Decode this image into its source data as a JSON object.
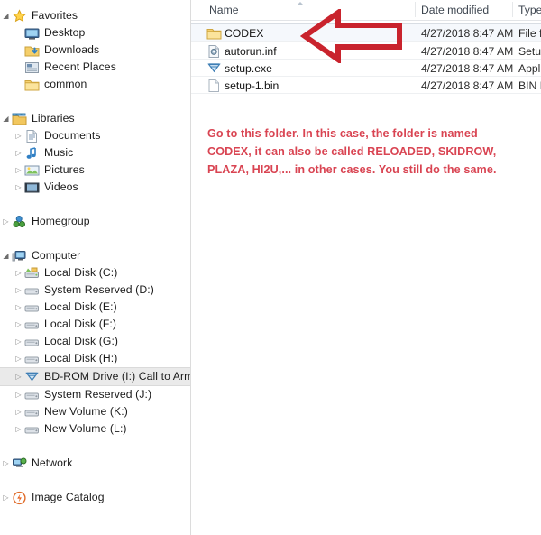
{
  "sidebar": {
    "groups": [
      {
        "name": "favorites",
        "header": {
          "label": "Favorites",
          "icon": "star-icon",
          "expanded": true
        },
        "items": [
          {
            "label": "Desktop",
            "icon": "desktop-icon",
            "chevron": "none"
          },
          {
            "label": "Downloads",
            "icon": "downloads-folder-icon",
            "chevron": "none"
          },
          {
            "label": "Recent Places",
            "icon": "recent-places-icon",
            "chevron": "none"
          },
          {
            "label": "common",
            "icon": "folder-icon",
            "chevron": "none"
          }
        ]
      },
      {
        "name": "libraries",
        "header": {
          "label": "Libraries",
          "icon": "libraries-icon",
          "expanded": true
        },
        "items": [
          {
            "label": "Documents",
            "icon": "document-icon",
            "chevron": "collapsed"
          },
          {
            "label": "Music",
            "icon": "music-note-icon",
            "chevron": "collapsed"
          },
          {
            "label": "Pictures",
            "icon": "picture-icon",
            "chevron": "collapsed"
          },
          {
            "label": "Videos",
            "icon": "video-icon",
            "chevron": "collapsed"
          }
        ]
      },
      {
        "name": "homegroup",
        "header": {
          "label": "Homegroup",
          "icon": "homegroup-icon",
          "expanded": false
        },
        "items": []
      },
      {
        "name": "computer",
        "header": {
          "label": "Computer",
          "icon": "computer-icon",
          "expanded": true
        },
        "items": [
          {
            "label": "Local Disk (C:)",
            "icon": "system-disk-icon",
            "chevron": "collapsed"
          },
          {
            "label": "System Reserved (D:)",
            "icon": "disk-icon",
            "chevron": "collapsed"
          },
          {
            "label": "Local Disk (E:)",
            "icon": "disk-icon",
            "chevron": "collapsed"
          },
          {
            "label": "Local Disk (F:)",
            "icon": "disk-icon",
            "chevron": "collapsed"
          },
          {
            "label": "Local Disk (G:)",
            "icon": "disk-icon",
            "chevron": "collapsed"
          },
          {
            "label": "Local Disk (H:)",
            "icon": "disk-icon",
            "chevron": "collapsed"
          },
          {
            "label": "BD-ROM Drive (I:) Call to Arms",
            "icon": "optical-drive-icon",
            "chevron": "collapsed",
            "selected": true
          },
          {
            "label": "System Reserved (J:)",
            "icon": "disk-icon",
            "chevron": "collapsed"
          },
          {
            "label": "New Volume (K:)",
            "icon": "disk-icon",
            "chevron": "collapsed"
          },
          {
            "label": "New Volume (L:)",
            "icon": "disk-icon",
            "chevron": "collapsed"
          }
        ]
      },
      {
        "name": "network",
        "header": {
          "label": "Network",
          "icon": "network-icon",
          "expanded": false
        },
        "items": []
      },
      {
        "name": "image-catalog",
        "header": {
          "label": "Image Catalog",
          "icon": "image-catalog-icon",
          "expanded": false
        },
        "items": []
      }
    ]
  },
  "file_list": {
    "columns": [
      {
        "key": "name",
        "label": "Name",
        "sorted": "ascending"
      },
      {
        "key": "date_modified",
        "label": "Date modified"
      },
      {
        "key": "type",
        "label": "Type"
      }
    ],
    "rows": [
      {
        "name": "CODEX",
        "date_modified": "4/27/2018 8:47 AM",
        "type": "File f",
        "icon": "folder-icon",
        "selected": true
      },
      {
        "name": "autorun.inf",
        "date_modified": "4/27/2018 8:47 AM",
        "type": "Setup",
        "icon": "inf-setup-information-icon",
        "selected": false
      },
      {
        "name": "setup.exe",
        "date_modified": "4/27/2018 8:47 AM",
        "type": "Appl",
        "icon": "installer-application-icon",
        "selected": false
      },
      {
        "name": "setup-1.bin",
        "date_modified": "4/27/2018 8:47 AM",
        "type": "BIN F",
        "icon": "blank-file-icon",
        "selected": false
      }
    ]
  },
  "annotations": {
    "arrow": {
      "name": "red-left-arrow",
      "direction": "left",
      "color": "#c9232d"
    },
    "instruction_text": "Go to this folder. In this case, the folder is named CODEX, it can also be called RELOADED, SKIDROW, PLAZA, HI2U,... in other cases. You still do the same.",
    "text_color": "#d94452"
  }
}
